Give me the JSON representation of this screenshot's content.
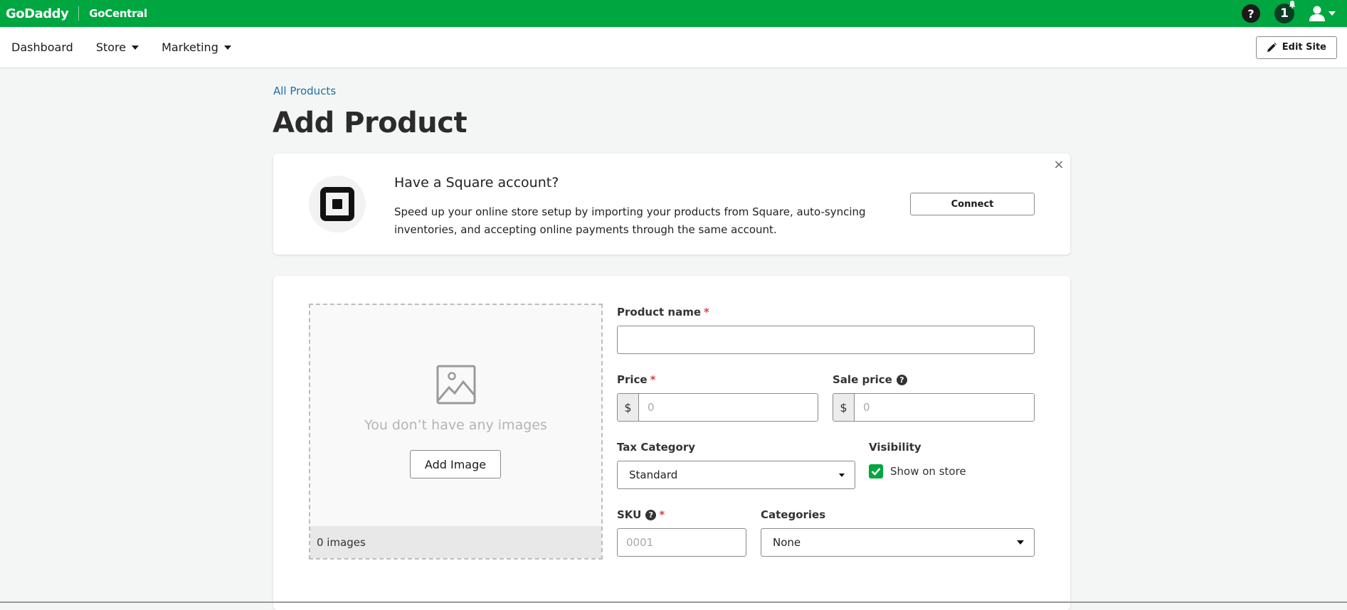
{
  "topbar": {
    "brand": "GoDaddy",
    "product": "GoCentral",
    "help_symbol": "?",
    "notifications_count": "1",
    "colors": {
      "background": "#00a63f"
    }
  },
  "nav": {
    "items": [
      {
        "label": "Dashboard",
        "has_caret": false
      },
      {
        "label": "Store",
        "has_caret": true
      },
      {
        "label": "Marketing",
        "has_caret": true
      }
    ],
    "edit_site_label": "Edit Site"
  },
  "breadcrumb": "All Products",
  "page_title": "Add Product",
  "square_banner": {
    "title": "Have a Square account?",
    "description": "Speed up your online store setup by importing your products from Square, auto-syncing inventories, and accepting online payments through the same account.",
    "connect_label": "Connect",
    "close_symbol": "×"
  },
  "images_panel": {
    "empty_text": "You don’t have any images",
    "add_image_label": "Add Image",
    "count_text": "0 images"
  },
  "form": {
    "product_name": {
      "label": "Product name",
      "required_mark": "*",
      "value": "",
      "placeholder": ""
    },
    "price": {
      "label": "Price",
      "required_mark": "*",
      "currency": "$",
      "placeholder": "0",
      "value": ""
    },
    "sale_price": {
      "label": "Sale price",
      "currency": "$",
      "placeholder": "0",
      "value": "",
      "help_symbol": "?"
    },
    "tax_category": {
      "label": "Tax Category",
      "selected": "Standard"
    },
    "visibility": {
      "label": "Visibility",
      "checkbox_label": "Show on store",
      "checked": true
    },
    "sku": {
      "label": "SKU",
      "required_mark": "*",
      "placeholder": "0001",
      "value": "",
      "help_symbol": "?"
    },
    "categories": {
      "label": "Categories",
      "selected": "None"
    }
  }
}
